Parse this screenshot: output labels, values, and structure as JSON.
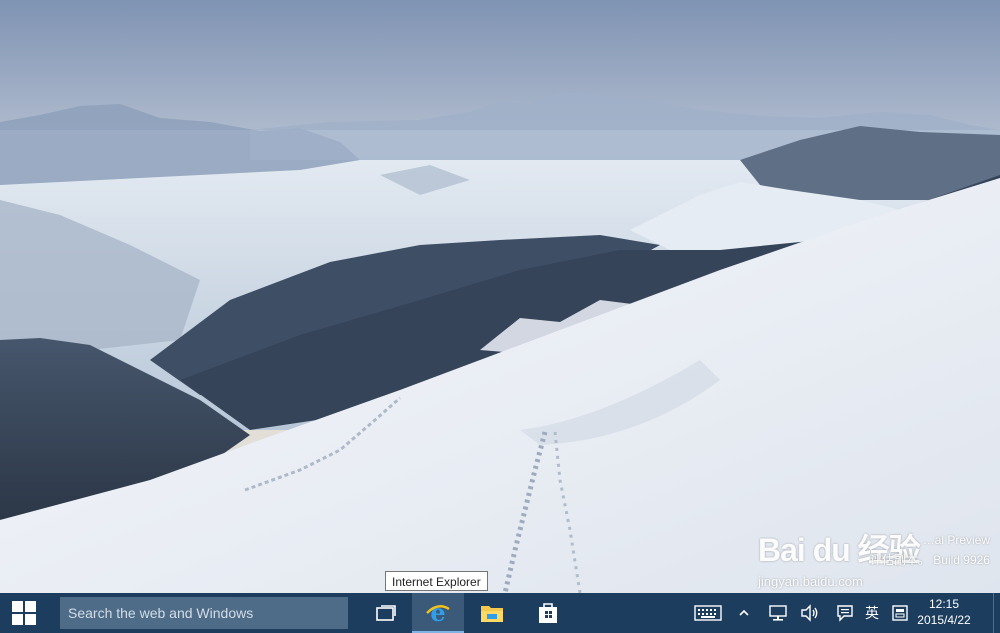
{
  "tooltip": {
    "text": "Internet Explorer"
  },
  "taskbar": {
    "search_placeholder": "Search the web and Windows",
    "ime_label": "英",
    "clock_time": "12:15",
    "clock_date": "2015/4/22"
  },
  "watermark": {
    "logo_text": "Bai du 经验",
    "site": "jingyan.baidu.com",
    "build_line1": "…al Preview",
    "build_line2": "评估副本。 Build 9926"
  },
  "colors": {
    "taskbar_bg": "#1d3d5e",
    "search_bg": "#4e6b87",
    "accent": "#7fb2e5"
  }
}
